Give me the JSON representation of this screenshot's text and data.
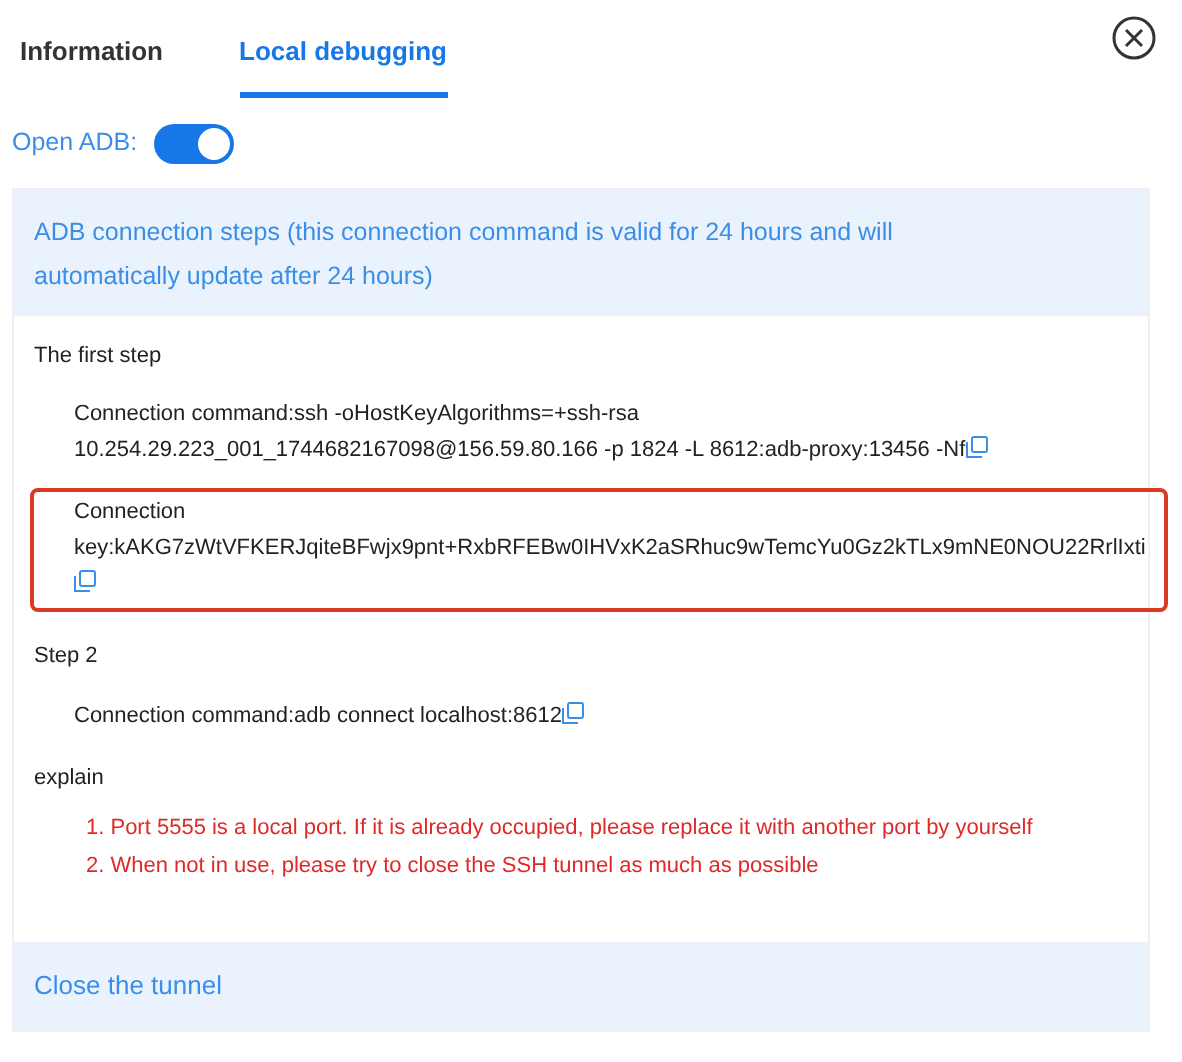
{
  "tabs": [
    {
      "label": "Information",
      "selected": false
    },
    {
      "label": "Local debugging",
      "selected": true
    }
  ],
  "adb_toggle": {
    "label": "Open ADB:",
    "on": true
  },
  "steps_header": "ADB connection steps (this connection command is valid for 24 hours and will automatically update after 24 hours)",
  "sections": [
    {
      "title": "The first step",
      "items": [
        {
          "text": "Connection command:ssh -oHostKeyAlgorithms=+ssh-rsa 10.254.29.223_001_1744682167098@156.59.80.166 -p 1824 -L 8612:adb-proxy:13456 -Nf",
          "highlighted": false
        },
        {
          "text": "Connection key:kAKG7zWtVFKERJqiteBFwjx9pnt+RxbRFEBw0IHVxK2aSRhuc9wTemcYu0Gz2kTLx9mNE0NOU22RrlIxti",
          "highlighted": true
        }
      ]
    },
    {
      "title": "Step 2",
      "items": [
        {
          "text": "Connection command:adb connect localhost:8612",
          "highlighted": false
        }
      ]
    }
  ],
  "explain": {
    "title": "explain",
    "notes": [
      "1. Port 5555 is a local port. If it is already occupied, please replace it with another port by yourself",
      "2. When not in use, please try to close the SSH tunnel as much as possible"
    ]
  },
  "close_tunnel": "Close the tunnel"
}
